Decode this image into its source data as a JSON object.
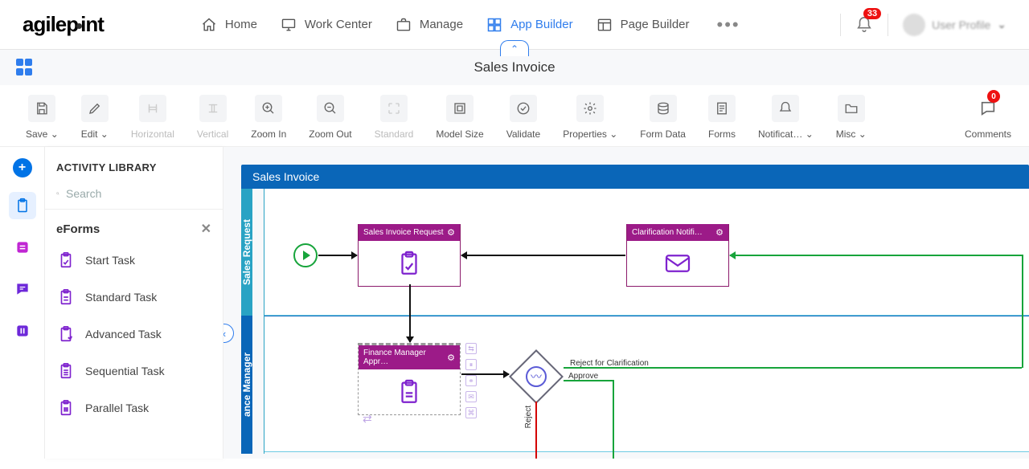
{
  "header": {
    "logo_a": "agilep",
    "logo_b": "int",
    "nav": [
      "Home",
      "Work Center",
      "Manage",
      "App Builder",
      "Page Builder"
    ],
    "notif_count": "33",
    "user_name": "User Profile"
  },
  "subheader": {
    "title": "Sales Invoice"
  },
  "toolbar": {
    "save": "Save",
    "edit": "Edit",
    "horizontal": "Horizontal",
    "vertical": "Vertical",
    "zoom_in": "Zoom In",
    "zoom_out": "Zoom Out",
    "standard": "Standard",
    "model_size": "Model Size",
    "validate": "Validate",
    "properties": "Properties",
    "form_data": "Form Data",
    "forms": "Forms",
    "notifications": "Notificat…",
    "misc": "Misc",
    "comments": "Comments",
    "comment_count": "0"
  },
  "library": {
    "title": "ACTIVITY LIBRARY",
    "search_placeholder": "Search",
    "section": "eForms",
    "items": [
      "Start Task",
      "Standard Task",
      "Advanced Task",
      "Sequential Task",
      "Parallel Task"
    ]
  },
  "process": {
    "title": "Sales Invoice",
    "lane1": "Sales Request",
    "lane2": "ance Manager",
    "act1": "Sales Invoice Request",
    "act2": "Clarification Notifi…",
    "act3": "Finance Manager Appr…",
    "c_reject_clar": "Reject for Clarification",
    "c_approve": "Approve",
    "c_reject": "Reject"
  }
}
